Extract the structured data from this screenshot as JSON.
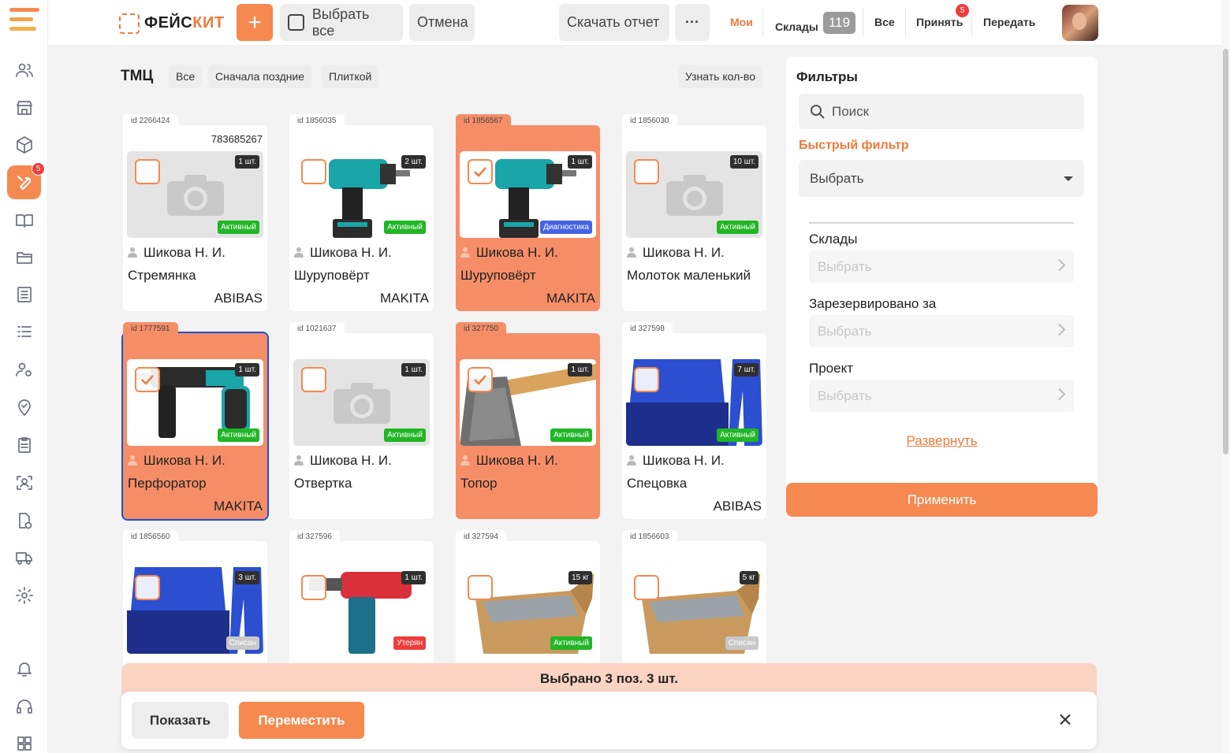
{
  "header": {
    "logo": {
      "part1": "ФЕЙС",
      "part2": "КИТ"
    },
    "add_label": "+",
    "select_all_label": "Выбрать все",
    "cancel_label": "Отмена",
    "report_label": "Скачать отчет",
    "more_label": "···",
    "tabs": {
      "mine": "Мои",
      "warehouses": "Склады",
      "warehouses_count": "119",
      "all": "Все",
      "accept": "Принять",
      "accept_badge": "5",
      "transfer": "Передать"
    }
  },
  "sidebar": {
    "active_badge": "5",
    "icons": [
      "users-icon",
      "store-icon",
      "box-icon",
      "tools-icon",
      "book-icon",
      "folder-icon",
      "list-icon",
      "lines-icon",
      "user-gear-icon",
      "location-check-icon",
      "clipboard-icon",
      "face-scan-icon",
      "doc-check-icon",
      "truck-icon",
      "settings-gear-icon",
      "bell-icon",
      "headset-icon",
      "grid-icon"
    ]
  },
  "toolbar": {
    "title": "ТМЦ",
    "chip_all": "Все",
    "chip_sort": "Сначала поздние",
    "chip_view": "Плиткой",
    "chip_count": "Узнать кол-во"
  },
  "items": [
    {
      "id": "id 2266424",
      "barcode": "783685267",
      "qty": "1 шт.",
      "status": "Активный",
      "owner": "Шикова Н. И.",
      "name": "Стремянка",
      "brand": "ABIBAS"
    },
    {
      "id": "id 1856035",
      "qty": "2 шт.",
      "status": "Активный",
      "owner": "Шикова Н. И.",
      "name": "Шуруповёрт",
      "brand": "MAKITA"
    },
    {
      "id": "id 1856567",
      "qty": "1 шт.",
      "status": "Диагностика",
      "owner": "Шикова Н. И.",
      "name": "Шуруповёрт",
      "brand": "MAKITA"
    },
    {
      "id": "id 1856030",
      "qty": "10 шт.",
      "status": "Активный",
      "owner": "Шикова Н. И.",
      "name": "Молоток маленький"
    },
    {
      "id": "id 1777591",
      "qty": "1 шт.",
      "status": "Активный",
      "owner": "Шикова Н. И.",
      "name": "Перфоратор",
      "brand": "MAKITA"
    },
    {
      "id": "id 1021637",
      "qty": "1 шт.",
      "status": "Активный",
      "owner": "Шикова Н. И.",
      "name": "Отвертка"
    },
    {
      "id": "id 327750",
      "qty": "1 шт.",
      "status": "Активный",
      "owner": "Шикова Н. И.",
      "name": "Топор"
    },
    {
      "id": "id 327598",
      "qty": "7 шт.",
      "status": "Активный",
      "owner": "Шикова Н. И.",
      "name": "Спецовка",
      "brand": "ABIBAS"
    },
    {
      "id": "id 1856560",
      "qty": "3 шт.",
      "status": "Списан"
    },
    {
      "id": "id 327596",
      "qty": "1 шт.",
      "status": "Утерян"
    },
    {
      "id": "id 327594",
      "qty": "15 кг",
      "status": "Активный"
    },
    {
      "id": "id 1856603",
      "qty": "5 кг",
      "status": "Списан"
    }
  ],
  "filters": {
    "title": "Фильтры",
    "search_placeholder": "Поиск",
    "quick_filter_label": "Быстрый фильтр",
    "quick_filter_value": "Выбрать",
    "warehouses_label": "Склады",
    "warehouses_value": "Выбрать",
    "reserved_label": "Зарезервировано за",
    "reserved_value": "Выбрать",
    "project_label": "Проект",
    "project_value": "Выбрать",
    "expand_label": "Развернуть",
    "apply_label": "Применить"
  },
  "selection": {
    "summary": "Выбрано 3 поз. 3 шт.",
    "show_label": "Показать",
    "move_label": "Переместить"
  },
  "colors": {
    "accent": "#f5894f",
    "active": "#21b626",
    "diagnostics": "#4762e6",
    "written_off": "#c8c8c8",
    "lost": "#ef3d3d"
  }
}
